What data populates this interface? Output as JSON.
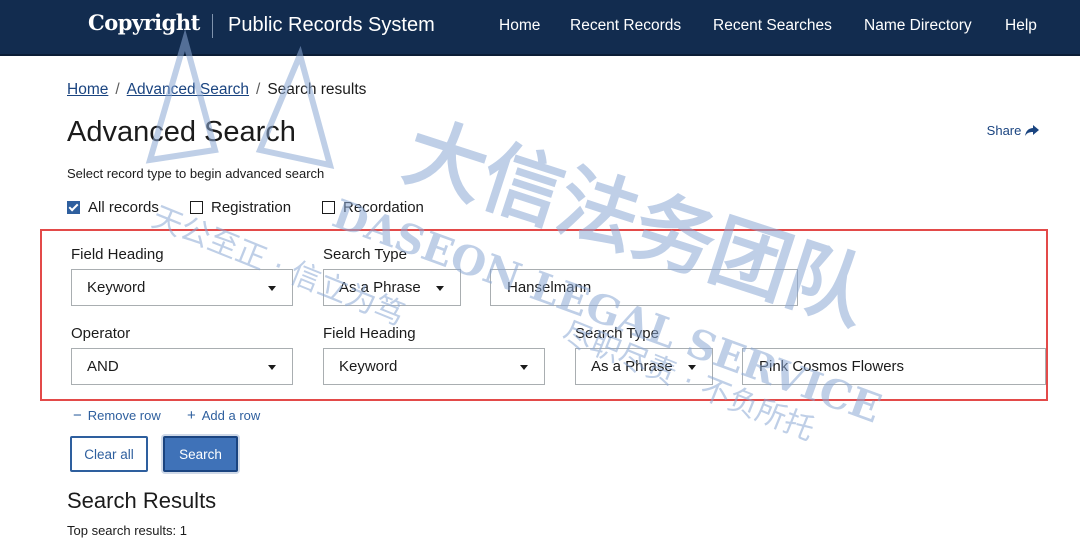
{
  "header": {
    "brand": "Copyright",
    "app_title": "Public Records System",
    "nav": [
      "Home",
      "Recent Records",
      "Recent Searches",
      "Name Directory",
      "Help"
    ]
  },
  "breadcrumb": {
    "home": "Home",
    "advanced": "Advanced Search",
    "current": "Search results"
  },
  "page_title": "Advanced Search",
  "share_label": "Share",
  "hint": "Select record type to begin advanced search",
  "record_types": [
    {
      "label": "All records",
      "checked": true
    },
    {
      "label": "Registration",
      "checked": false
    },
    {
      "label": "Recordation",
      "checked": false
    }
  ],
  "row1": {
    "field_heading_label": "Field Heading",
    "field_heading_value": "Keyword",
    "search_type_label": "Search Type",
    "search_type_value": "As a Phrase",
    "term": "Hanselmann"
  },
  "row2": {
    "operator_label": "Operator",
    "operator_value": "AND",
    "field_heading_label": "Field Heading",
    "field_heading_value": "Keyword",
    "search_type_label": "Search Type",
    "search_type_value": "As a Phrase",
    "term": "Pink Cosmos Flowers"
  },
  "actions": {
    "remove_row": "Remove row",
    "add_row": "Add a row",
    "clear_all": "Clear all",
    "search": "Search"
  },
  "results": {
    "heading": "Search Results",
    "count_text": "Top search results: 1"
  },
  "watermark": {
    "cn_main": "大信法务团队",
    "en": "DASEON LEGAL SERVICE",
    "cn_slogan_1": "天公至正 · 信立为笃",
    "cn_slogan_2": "尽职尽责 · 不负所托"
  },
  "colors": {
    "header_bg": "#122c4f",
    "link": "#1a4480",
    "accent": "#2e5f9e",
    "highlight_box": "#e34a49",
    "watermark": "#8aa8d4"
  }
}
